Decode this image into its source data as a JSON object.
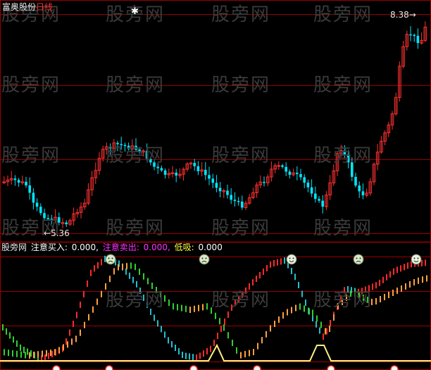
{
  "header": {
    "brand": "富奥股份",
    "period": "日线"
  },
  "price_panel": {
    "high_label": "8.38",
    "low_label": "5.36",
    "star_glyph": "✱"
  },
  "indicator_panel": {
    "name": "股旁网",
    "buy_label": "注意买入:",
    "buy_value": "0.000,",
    "sell_label": "注意卖出:",
    "sell_value": "0.000,",
    "low_label": "低吸:",
    "low_value": "0.000"
  },
  "watermark_text": "股旁网",
  "colors": {
    "background": "#000000",
    "up_candle": "#ff3030",
    "down_candle": "#00e5ff",
    "grid": "#9b0000",
    "indicator_red": "#ff2a2a",
    "indicator_orange": "#ffa040",
    "indicator_green": "#30d030",
    "indicator_cyan": "#20c0d0",
    "low_line": "#fff080",
    "sell_color": "#ff30ff",
    "low_color": "#ffff40"
  },
  "icons": [
    "sad-face-icon",
    "sad-face-icon",
    "buy-signal-icon",
    "sad-face-icon",
    "buy-signal-icon"
  ]
}
